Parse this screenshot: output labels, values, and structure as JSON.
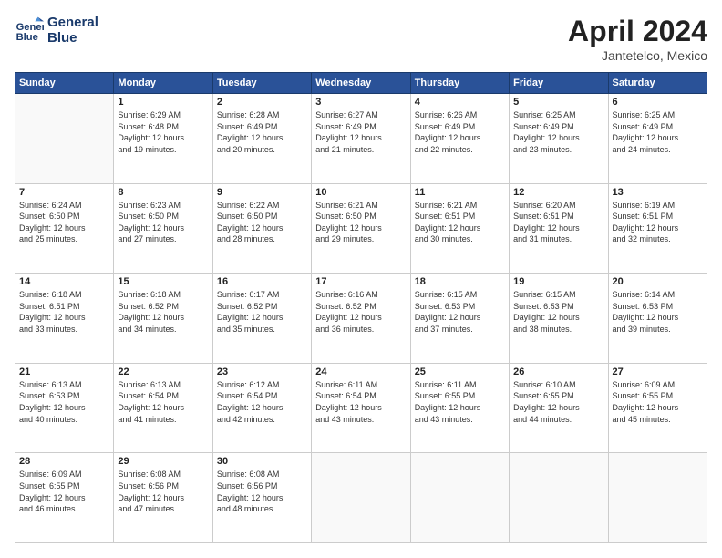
{
  "header": {
    "logo_line1": "General",
    "logo_line2": "Blue",
    "month": "April 2024",
    "location": "Jantetelco, Mexico"
  },
  "weekdays": [
    "Sunday",
    "Monday",
    "Tuesday",
    "Wednesday",
    "Thursday",
    "Friday",
    "Saturday"
  ],
  "weeks": [
    [
      {
        "day": "",
        "detail": ""
      },
      {
        "day": "1",
        "detail": "Sunrise: 6:29 AM\nSunset: 6:48 PM\nDaylight: 12 hours\nand 19 minutes."
      },
      {
        "day": "2",
        "detail": "Sunrise: 6:28 AM\nSunset: 6:49 PM\nDaylight: 12 hours\nand 20 minutes."
      },
      {
        "day": "3",
        "detail": "Sunrise: 6:27 AM\nSunset: 6:49 PM\nDaylight: 12 hours\nand 21 minutes."
      },
      {
        "day": "4",
        "detail": "Sunrise: 6:26 AM\nSunset: 6:49 PM\nDaylight: 12 hours\nand 22 minutes."
      },
      {
        "day": "5",
        "detail": "Sunrise: 6:25 AM\nSunset: 6:49 PM\nDaylight: 12 hours\nand 23 minutes."
      },
      {
        "day": "6",
        "detail": "Sunrise: 6:25 AM\nSunset: 6:49 PM\nDaylight: 12 hours\nand 24 minutes."
      }
    ],
    [
      {
        "day": "7",
        "detail": "Sunrise: 6:24 AM\nSunset: 6:50 PM\nDaylight: 12 hours\nand 25 minutes."
      },
      {
        "day": "8",
        "detail": "Sunrise: 6:23 AM\nSunset: 6:50 PM\nDaylight: 12 hours\nand 27 minutes."
      },
      {
        "day": "9",
        "detail": "Sunrise: 6:22 AM\nSunset: 6:50 PM\nDaylight: 12 hours\nand 28 minutes."
      },
      {
        "day": "10",
        "detail": "Sunrise: 6:21 AM\nSunset: 6:50 PM\nDaylight: 12 hours\nand 29 minutes."
      },
      {
        "day": "11",
        "detail": "Sunrise: 6:21 AM\nSunset: 6:51 PM\nDaylight: 12 hours\nand 30 minutes."
      },
      {
        "day": "12",
        "detail": "Sunrise: 6:20 AM\nSunset: 6:51 PM\nDaylight: 12 hours\nand 31 minutes."
      },
      {
        "day": "13",
        "detail": "Sunrise: 6:19 AM\nSunset: 6:51 PM\nDaylight: 12 hours\nand 32 minutes."
      }
    ],
    [
      {
        "day": "14",
        "detail": "Sunrise: 6:18 AM\nSunset: 6:51 PM\nDaylight: 12 hours\nand 33 minutes."
      },
      {
        "day": "15",
        "detail": "Sunrise: 6:18 AM\nSunset: 6:52 PM\nDaylight: 12 hours\nand 34 minutes."
      },
      {
        "day": "16",
        "detail": "Sunrise: 6:17 AM\nSunset: 6:52 PM\nDaylight: 12 hours\nand 35 minutes."
      },
      {
        "day": "17",
        "detail": "Sunrise: 6:16 AM\nSunset: 6:52 PM\nDaylight: 12 hours\nand 36 minutes."
      },
      {
        "day": "18",
        "detail": "Sunrise: 6:15 AM\nSunset: 6:53 PM\nDaylight: 12 hours\nand 37 minutes."
      },
      {
        "day": "19",
        "detail": "Sunrise: 6:15 AM\nSunset: 6:53 PM\nDaylight: 12 hours\nand 38 minutes."
      },
      {
        "day": "20",
        "detail": "Sunrise: 6:14 AM\nSunset: 6:53 PM\nDaylight: 12 hours\nand 39 minutes."
      }
    ],
    [
      {
        "day": "21",
        "detail": "Sunrise: 6:13 AM\nSunset: 6:53 PM\nDaylight: 12 hours\nand 40 minutes."
      },
      {
        "day": "22",
        "detail": "Sunrise: 6:13 AM\nSunset: 6:54 PM\nDaylight: 12 hours\nand 41 minutes."
      },
      {
        "day": "23",
        "detail": "Sunrise: 6:12 AM\nSunset: 6:54 PM\nDaylight: 12 hours\nand 42 minutes."
      },
      {
        "day": "24",
        "detail": "Sunrise: 6:11 AM\nSunset: 6:54 PM\nDaylight: 12 hours\nand 43 minutes."
      },
      {
        "day": "25",
        "detail": "Sunrise: 6:11 AM\nSunset: 6:55 PM\nDaylight: 12 hours\nand 43 minutes."
      },
      {
        "day": "26",
        "detail": "Sunrise: 6:10 AM\nSunset: 6:55 PM\nDaylight: 12 hours\nand 44 minutes."
      },
      {
        "day": "27",
        "detail": "Sunrise: 6:09 AM\nSunset: 6:55 PM\nDaylight: 12 hours\nand 45 minutes."
      }
    ],
    [
      {
        "day": "28",
        "detail": "Sunrise: 6:09 AM\nSunset: 6:55 PM\nDaylight: 12 hours\nand 46 minutes."
      },
      {
        "day": "29",
        "detail": "Sunrise: 6:08 AM\nSunset: 6:56 PM\nDaylight: 12 hours\nand 47 minutes."
      },
      {
        "day": "30",
        "detail": "Sunrise: 6:08 AM\nSunset: 6:56 PM\nDaylight: 12 hours\nand 48 minutes."
      },
      {
        "day": "",
        "detail": ""
      },
      {
        "day": "",
        "detail": ""
      },
      {
        "day": "",
        "detail": ""
      },
      {
        "day": "",
        "detail": ""
      }
    ]
  ]
}
